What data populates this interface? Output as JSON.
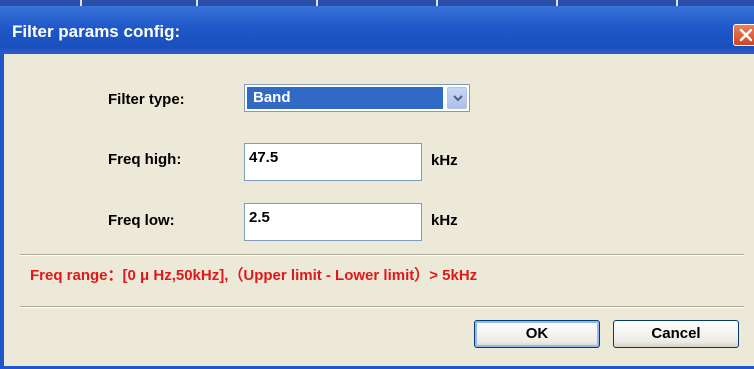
{
  "dialog": {
    "title": "Filter params config:",
    "close_icon": "close-icon"
  },
  "form": {
    "filter_type_label": "Filter type:",
    "filter_type_value": "Band",
    "freq_high_label": "Freq high:",
    "freq_high_value": "47.5",
    "freq_high_unit": "kHz",
    "freq_low_label": "Freq low:",
    "freq_low_value": "2.5",
    "freq_low_unit": "kHz"
  },
  "note": "Freq range：[0 μ Hz,50kHz],（Upper limit - Lower limit）> 5kHz",
  "buttons": {
    "ok_label": "OK",
    "cancel_label": "Cancel"
  },
  "colors": {
    "title_bar": "#1f58c8",
    "note_text": "#e01818",
    "selection": "#316ac5"
  }
}
